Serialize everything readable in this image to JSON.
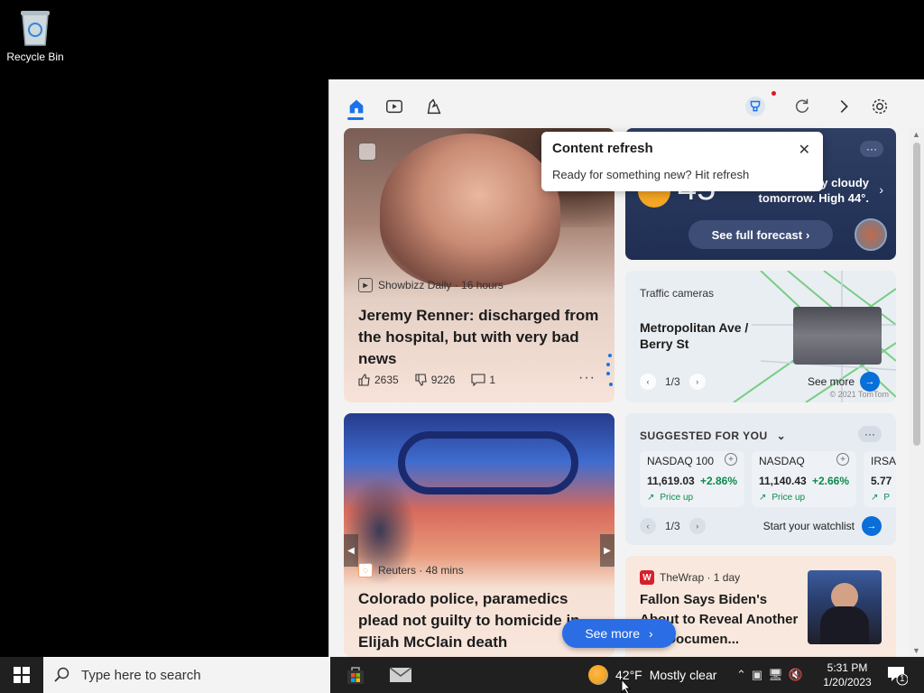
{
  "desktop": {
    "recycle_bin_label": "Recycle Bin"
  },
  "widgets": {
    "toolbar": {
      "icons": [
        "home-icon",
        "video-icon",
        "game-icon",
        "rewards-icon",
        "refresh-icon",
        "next-icon",
        "settings-icon"
      ]
    },
    "tooltip": {
      "title": "Content refresh",
      "body": "Ready for something new? Hit refresh"
    },
    "news1": {
      "source": "Showbizz Daily · 16 hours",
      "headline": "Jeremy Renner: discharged from the hospital, but with very bad news",
      "likes": "2635",
      "dislikes": "9226",
      "comments": "1"
    },
    "weather": {
      "temp": "45",
      "forecast_line1": "y cloudy",
      "forecast_line2": "tomorrow. High 44°.",
      "full_forecast": "See full forecast"
    },
    "traffic": {
      "title": "Traffic cameras",
      "location_line1": "Metropolitan Ave /",
      "location_line2": "Berry St",
      "pager": "1/3",
      "see_more": "See more",
      "copyright": "© 2021 TomTom"
    },
    "stocks": {
      "title": "SUGGESTED FOR YOU",
      "items": [
        {
          "name": "NASDAQ 100",
          "value": "11,619.03",
          "change": "+2.86%",
          "trend": "Price up"
        },
        {
          "name": "NASDAQ",
          "value": "11,140.43",
          "change": "+2.66%",
          "trend": "Price up"
        },
        {
          "name": "IRSA",
          "value": "5.77",
          "change": "",
          "trend": "P"
        }
      ],
      "pager": "1/3",
      "watchlist": "Start your watchlist"
    },
    "news2": {
      "source": "Reuters · 48 mins",
      "headline": "Colorado police, paramedics plead not guilty to homicide in Elijah McClain death"
    },
    "news3": {
      "source": "TheWrap · 1 day",
      "headline": "Fallon Says Biden's About to Reveal Another 100 Documen..."
    },
    "see_more": "See more"
  },
  "taskbar": {
    "search_placeholder": "Type here to search",
    "weather": {
      "temp": "42°F",
      "condition": "Mostly clear"
    },
    "time": "5:31 PM",
    "date": "1/20/2023",
    "notification_count": "1"
  },
  "colors": {
    "accent": "#1a73e8",
    "taskbar": "#202020",
    "positive": "#0e8a4b"
  }
}
